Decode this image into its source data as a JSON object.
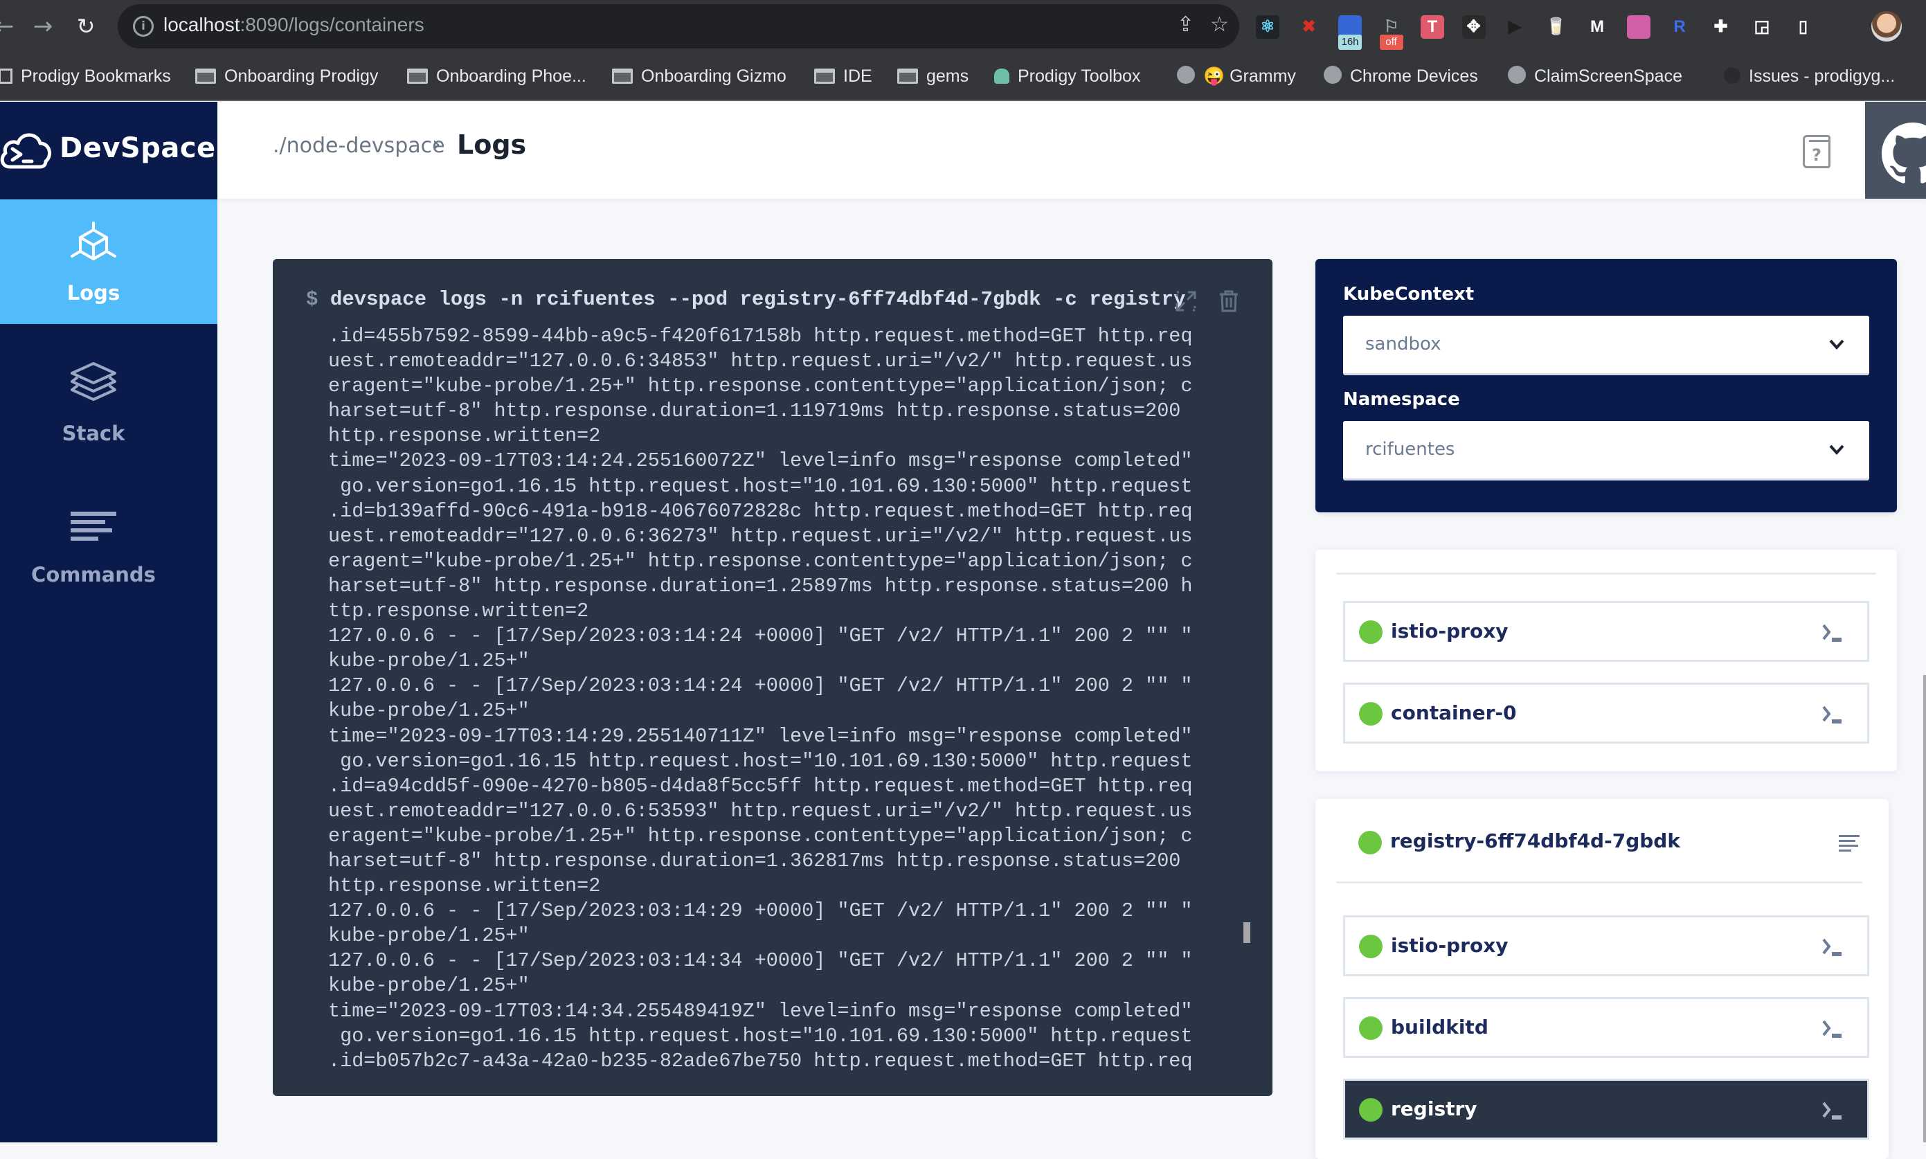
{
  "browser": {
    "url_host": "localhost",
    "url_path": ":8090/logs/containers",
    "extensions": [
      {
        "name": "react-devtools",
        "glyph": "⚛",
        "bg": "#20232a",
        "fg": "#61dafb"
      },
      {
        "name": "x-extension",
        "glyph": "✖",
        "bg": "transparent",
        "fg": "#d93025"
      },
      {
        "name": "timer-extension",
        "glyph": "",
        "bg": "#3367d6",
        "fg": "#ffffff",
        "badge": "16h",
        "badge_bg": "#a8dde4",
        "badge_fg": "#202124"
      },
      {
        "name": "flag-extension",
        "glyph": "⚐",
        "bg": "transparent",
        "fg": "#9aa0a6",
        "badge": "off",
        "badge_bg": "#e8594f",
        "badge_fg": "#ffffff"
      },
      {
        "name": "tape-extension",
        "glyph": "T",
        "bg": "#e05a6e",
        "fg": "#ffffff"
      },
      {
        "name": "measure-extension",
        "glyph": "✥",
        "bg": "#2a2a2a",
        "fg": "#ffffff"
      },
      {
        "name": "play-extension",
        "glyph": "▶",
        "bg": "transparent",
        "fg": "#1e1e1e"
      },
      {
        "name": "milk-extension",
        "glyph": "🥛",
        "bg": "transparent",
        "fg": "#4a8cff"
      },
      {
        "name": "m-extension",
        "glyph": "M",
        "bg": "transparent",
        "fg": "#ffffff"
      },
      {
        "name": "gradient-extension",
        "glyph": "",
        "bg": "#d05fa8",
        "fg": "#ffffff"
      },
      {
        "name": "r-extension",
        "glyph": "R",
        "bg": "transparent",
        "fg": "#3a6df0"
      },
      {
        "name": "puzzle-extension",
        "glyph": "✚",
        "bg": "transparent",
        "fg": "#ffffff"
      },
      {
        "name": "cast-extension",
        "glyph": "◲",
        "bg": "transparent",
        "fg": "#ffffff"
      },
      {
        "name": "sidepanel-extension",
        "glyph": "▯",
        "bg": "transparent",
        "fg": "#ffffff"
      }
    ],
    "bookmarks": [
      {
        "label": "Prodigy Bookmarks",
        "icon": "bookmark-page-icon"
      },
      {
        "label": "Onboarding Prodigy",
        "icon": "folder-icon"
      },
      {
        "label": "Onboarding Phoe...",
        "icon": "folder-icon"
      },
      {
        "label": "Onboarding Gizmo",
        "icon": "folder-icon"
      },
      {
        "label": "IDE",
        "icon": "folder-icon"
      },
      {
        "label": "gems",
        "icon": "folder-icon"
      },
      {
        "label": "Prodigy Toolbox",
        "icon": "monster-icon"
      },
      {
        "label": "😜 Grammy",
        "icon": "globe-icon"
      },
      {
        "label": "Chrome Devices",
        "icon": "globe-icon"
      },
      {
        "label": "ClaimScreenSpace",
        "icon": "globe-icon"
      },
      {
        "label": "Issues - prodigyg...",
        "icon": "github-icon"
      }
    ]
  },
  "app": {
    "brand": "DevSpace",
    "sidebar": {
      "items": [
        {
          "label": "Logs",
          "icon": "cube-icon",
          "active": true
        },
        {
          "label": "Stack",
          "icon": "layers-icon",
          "active": false
        },
        {
          "label": "Commands",
          "icon": "lines-icon",
          "active": false
        }
      ]
    },
    "header": {
      "breadcrumb_parent": "./node-devspace",
      "breadcrumb_sep": "›",
      "breadcrumb_current": "Logs",
      "help_label": "?"
    },
    "terminal": {
      "prompt": "$",
      "command": "devspace logs -n rcifuentes --pod registry-6ff74dbf4d-7gbdk -c registry",
      "lines": [
        ".id=455b7592-8599-44bb-a9c5-f420f617158b http.request.method=GET http.req",
        "uest.remoteaddr=\"127.0.0.6:34853\" http.request.uri=\"/v2/\" http.request.us",
        "eragent=\"kube-probe/1.25+\" http.response.contenttype=\"application/json; c",
        "harset=utf-8\" http.response.duration=1.119719ms http.response.status=200",
        "http.response.written=2",
        "time=\"2023-09-17T03:14:24.255160072Z\" level=info msg=\"response completed\"",
        " go.version=go1.16.15 http.request.host=\"10.101.69.130:5000\" http.request",
        ".id=b139affd-90c6-491a-b918-40676072828c http.request.method=GET http.req",
        "uest.remoteaddr=\"127.0.0.6:36273\" http.request.uri=\"/v2/\" http.request.us",
        "eragent=\"kube-probe/1.25+\" http.response.contenttype=\"application/json; c",
        "harset=utf-8\" http.response.duration=1.25897ms http.response.status=200 h",
        "ttp.response.written=2",
        "127.0.0.6 - - [17/Sep/2023:03:14:24 +0000] \"GET /v2/ HTTP/1.1\" 200 2 \"\" \"",
        "kube-probe/1.25+\"",
        "127.0.0.6 - - [17/Sep/2023:03:14:24 +0000] \"GET /v2/ HTTP/1.1\" 200 2 \"\" \"",
        "kube-probe/1.25+\"",
        "time=\"2023-09-17T03:14:29.255140711Z\" level=info msg=\"response completed\"",
        " go.version=go1.16.15 http.request.host=\"10.101.69.130:5000\" http.request",
        ".id=a94cdd5f-090e-4270-b805-d4da8f5cc5ff http.request.method=GET http.req",
        "uest.remoteaddr=\"127.0.0.6:53593\" http.request.uri=\"/v2/\" http.request.us",
        "eragent=\"kube-probe/1.25+\" http.response.contenttype=\"application/json; c",
        "harset=utf-8\" http.response.duration=1.362817ms http.response.status=200",
        "http.response.written=2",
        "127.0.0.6 - - [17/Sep/2023:03:14:29 +0000] \"GET /v2/ HTTP/1.1\" 200 2 \"\" \"",
        "kube-probe/1.25+\"",
        "127.0.0.6 - - [17/Sep/2023:03:14:34 +0000] \"GET /v2/ HTTP/1.1\" 200 2 \"\" \"",
        "kube-probe/1.25+\"",
        "time=\"2023-09-17T03:14:34.255489419Z\" level=info msg=\"response completed\"",
        " go.version=go1.16.15 http.request.host=\"10.101.69.130:5000\" http.request",
        ".id=b057b2c7-a43a-42a0-b235-82ade67be750 http.request.method=GET http.req"
      ]
    },
    "context_panel": {
      "kubecontext_label": "KubeContext",
      "kubecontext_value": "sandbox",
      "namespace_label": "Namespace",
      "namespace_value": "rcifuentes"
    },
    "pods": [
      {
        "name": "",
        "containers": [
          {
            "name": "istio-proxy",
            "status": "running",
            "active": false
          },
          {
            "name": "container-0",
            "status": "running",
            "active": false
          }
        ]
      },
      {
        "name": "registry-6ff74dbf4d-7gbdk",
        "status": "running",
        "containers": [
          {
            "name": "istio-proxy",
            "status": "running",
            "active": false
          },
          {
            "name": "buildkitd",
            "status": "running",
            "active": false
          },
          {
            "name": "registry",
            "status": "running",
            "active": true
          }
        ]
      }
    ],
    "colors": {
      "navy": "#0a1a4a",
      "active_blue": "#52bbfa",
      "terminal_bg": "#293545",
      "status_green": "#6cc740"
    }
  }
}
